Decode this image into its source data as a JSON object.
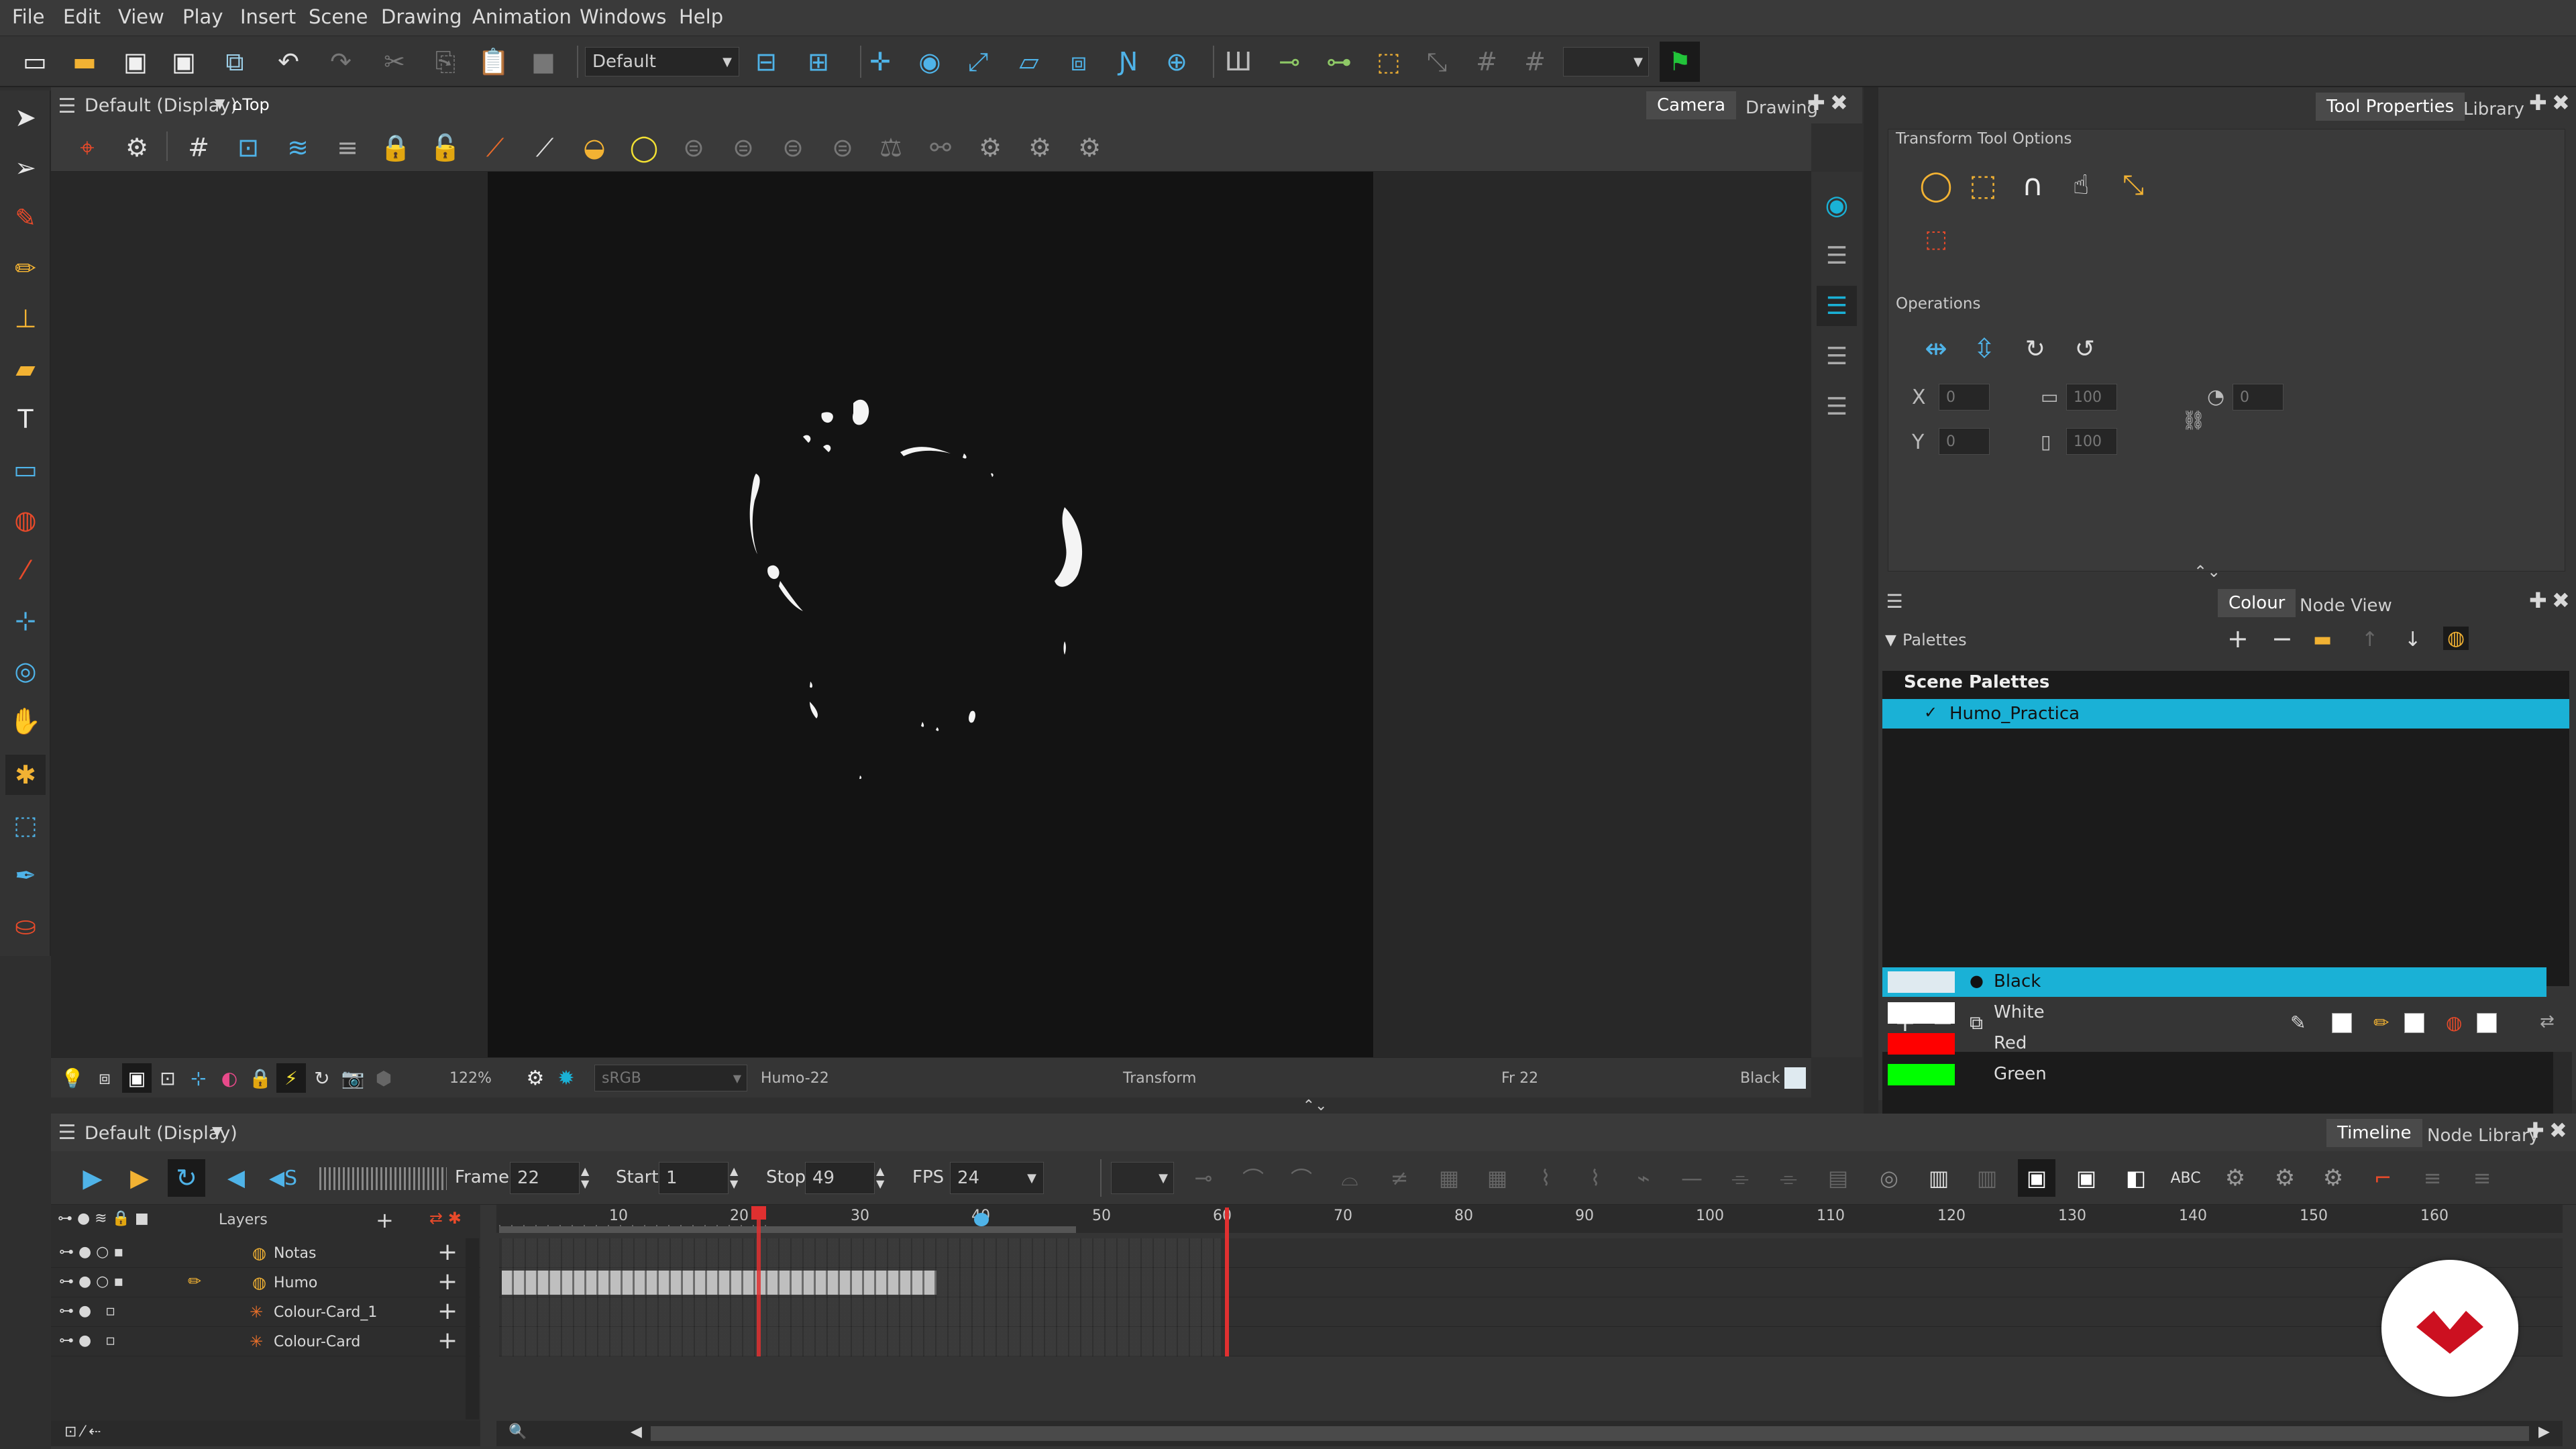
{
  "menubar": {
    "items": [
      "File",
      "Edit",
      "View",
      "Play",
      "Insert",
      "Scene",
      "Drawing",
      "Animation",
      "Windows",
      "Help"
    ]
  },
  "toolbar": {
    "workspace_value": "Default"
  },
  "view": {
    "title": "Default (Display)",
    "view_mode": "Top",
    "tabs": [
      "Camera",
      "Drawing"
    ],
    "status": {
      "zoom": "122%",
      "color_space": "sRGB",
      "drawing_name": "Humo-22",
      "tool": "Transform",
      "frame": "Fr 22",
      "colour": "Black"
    }
  },
  "tool_properties": {
    "tabs": [
      "Tool Properties",
      "Library"
    ],
    "section_title": "Transform Tool Options",
    "operations_title": "Operations",
    "fields": {
      "x": "0",
      "y": "0",
      "width": "100",
      "height": "100",
      "angle": "0"
    }
  },
  "colour_panel": {
    "tabs": [
      "Colour",
      "Node View"
    ],
    "palettes_label": "Palettes",
    "scene_palettes_label": "Scene Palettes",
    "palette_name": "Humo_Practica",
    "colours": [
      {
        "name": "Black",
        "hex": "#dfeaf0",
        "selected": true
      },
      {
        "name": "White",
        "hex": "#ffffff",
        "selected": false
      },
      {
        "name": "Red",
        "hex": "#ff0000",
        "selected": false
      },
      {
        "name": "Green",
        "hex": "#00ff00",
        "selected": false
      }
    ]
  },
  "timeline": {
    "title": "Default (Display)",
    "tabs": [
      "Timeline",
      "Node Library"
    ],
    "frame_label": "Frame",
    "frame_value": "22",
    "start_label": "Start",
    "start_value": "1",
    "stop_label": "Stop",
    "stop_value": "49",
    "fps_label": "FPS",
    "fps_value": "24",
    "layers_label": "Layers",
    "layers": [
      {
        "name": "Notas",
        "type": "drawing"
      },
      {
        "name": "Humo",
        "type": "drawing"
      },
      {
        "name": "Colour-Card_1",
        "type": "colour-card"
      },
      {
        "name": "Colour-Card",
        "type": "colour-card"
      }
    ],
    "ruler_ticks": [
      "10",
      "20",
      "30",
      "40",
      "50",
      "60",
      "70",
      "80",
      "90",
      "100",
      "110",
      "120",
      "130",
      "140",
      "150",
      "160"
    ]
  },
  "colors": {
    "accent": "#1ab1d6",
    "playhead": "#e03030",
    "logo_red": "#cc1020"
  }
}
